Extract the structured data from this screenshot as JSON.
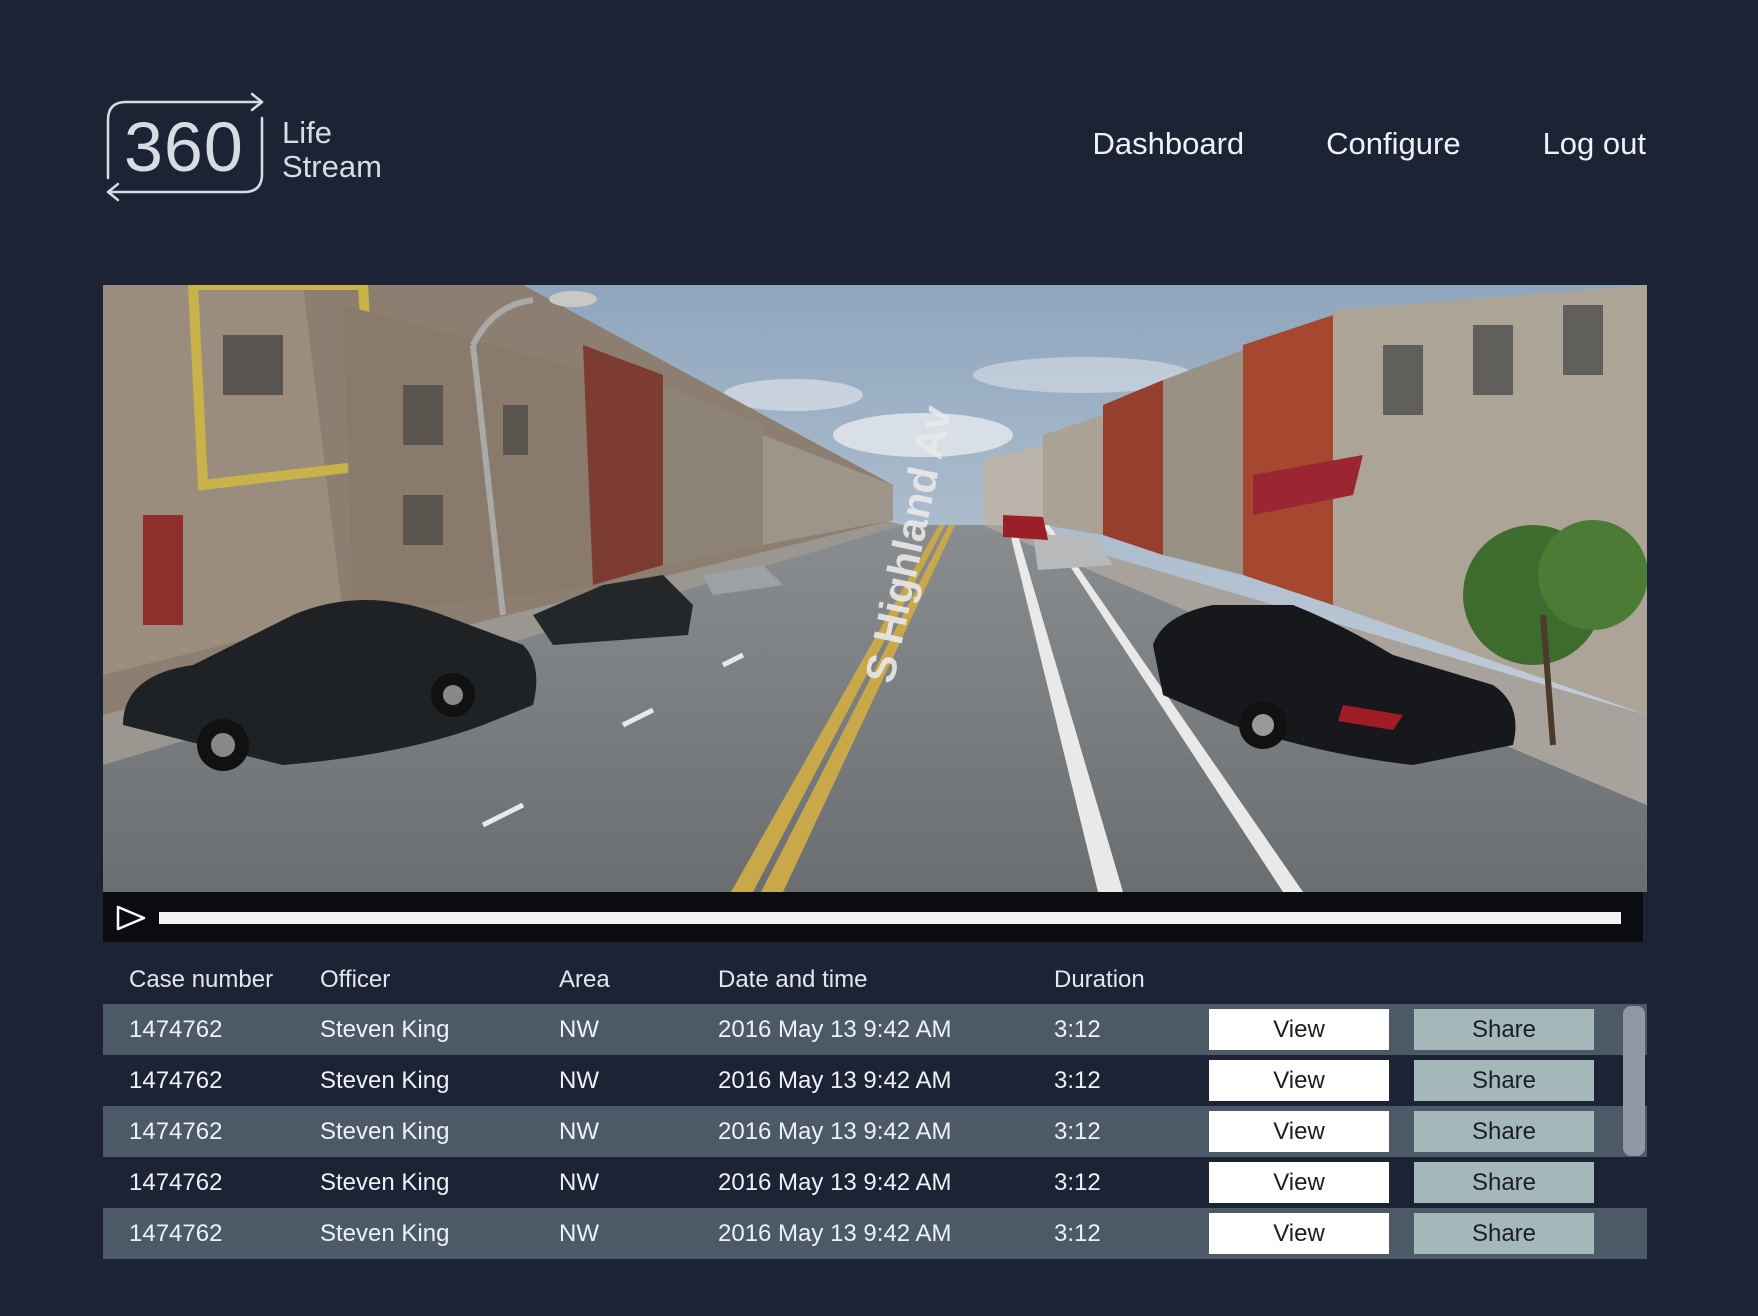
{
  "logo": {
    "number": "360",
    "word1": "Life",
    "word2": "Stream"
  },
  "nav": {
    "dashboard": "Dashboard",
    "configure": "Configure",
    "logout": "Log out"
  },
  "video": {
    "street_sign": "S Highland Av",
    "progress": 0.0
  },
  "table": {
    "headers": [
      "Case number",
      "Officer",
      "Area",
      "Date and time",
      "Duration"
    ],
    "rows": [
      {
        "case": "1474762",
        "officer": "Steven King",
        "area": "NW",
        "datetime": "2016 May 13 9:42 AM",
        "duration": "3:12",
        "view": "View",
        "share": "Share"
      },
      {
        "case": "1474762",
        "officer": "Steven King",
        "area": "NW",
        "datetime": "2016 May 13 9:42 AM",
        "duration": "3:12",
        "view": "View",
        "share": "Share"
      },
      {
        "case": "1474762",
        "officer": "Steven King",
        "area": "NW",
        "datetime": "2016 May 13 9:42 AM",
        "duration": "3:12",
        "view": "View",
        "share": "Share"
      },
      {
        "case": "1474762",
        "officer": "Steven King",
        "area": "NW",
        "datetime": "2016 May 13 9:42 AM",
        "duration": "3:12",
        "view": "View",
        "share": "Share"
      },
      {
        "case": "1474762",
        "officer": "Steven King",
        "area": "NW",
        "datetime": "2016 May 13 9:42 AM",
        "duration": "3:12",
        "view": "View",
        "share": "Share"
      }
    ]
  },
  "colors": {
    "background": "#1b2335",
    "row_shade": "#4c5967",
    "share_button": "#a5b8b9",
    "view_button": "#ffffff"
  },
  "icons": {
    "play": "play-icon",
    "logo_arrows": "circular-arrows-icon"
  }
}
